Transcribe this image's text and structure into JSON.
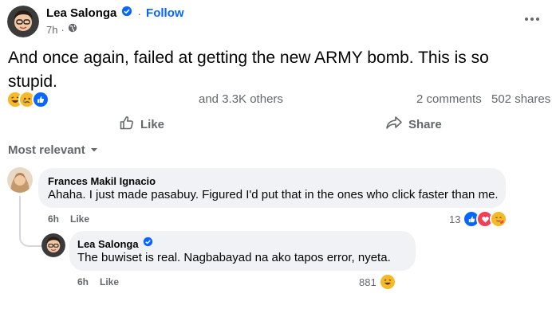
{
  "post": {
    "author": "Lea Salonga",
    "follow_label": "Follow",
    "separator": "·",
    "time": "7h",
    "time_dot": "·",
    "text": "And once again, failed at getting the new ARMY bomb. This is so stupid.",
    "reactions_summary": "and 3.3K others",
    "comments_count": "2 comments",
    "shares_count": "502 shares",
    "reaction_icons": [
      "haha-icon",
      "sad-icon",
      "like-icon"
    ]
  },
  "actions": {
    "like_label": "Like",
    "share_label": "Share"
  },
  "sort": {
    "label": "Most relevant"
  },
  "comments": [
    {
      "author": "Frances Makil Ignacio",
      "text": "Ahaha. I just made pasabuy. Figured I'd put that in the ones who click faster than me.",
      "time": "6h",
      "like_label": "Like",
      "reaction_count": "13",
      "reaction_icons": [
        "like-icon",
        "love-icon",
        "hug-icon"
      ]
    },
    {
      "author": "Lea Salonga",
      "text": "The buwiset is real. Nagbabayad na ako tapos error, nyeta.",
      "time": "6h",
      "like_label": "Like",
      "reaction_count": "881",
      "reaction_icons": [
        "haha-icon"
      ]
    }
  ],
  "colors": {
    "accent": "#0866ff",
    "muted": "#65676b",
    "bubble": "#f0f2f5"
  }
}
